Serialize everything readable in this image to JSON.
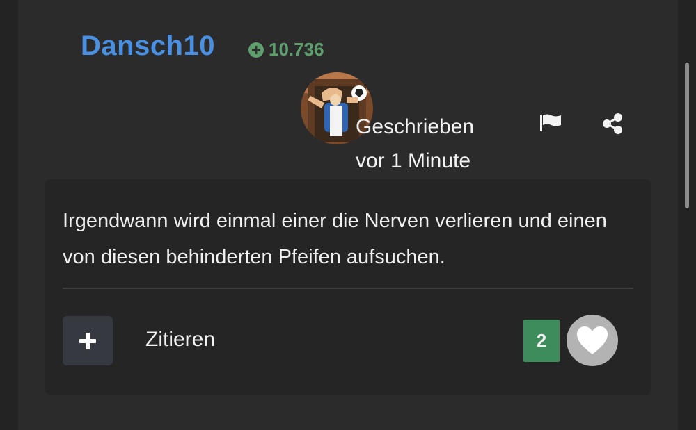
{
  "author": {
    "name": "Dansch10",
    "reputation": "10.736",
    "reputation_icon": "plus-circle-icon"
  },
  "meta": {
    "written_label": "Geschrieben",
    "time_ago": "vor 1 Minute"
  },
  "post": {
    "text": "Irgendwann wird einmal einer die Nerven verlieren und einen von diesen behinderten Pfeifen aufsuchen."
  },
  "actions": {
    "quote_label": "Zitieren",
    "like_count": "2",
    "plus_icon": "plus-icon",
    "like_icon": "heart-icon",
    "report_icon": "flag-icon",
    "share_icon": "share-icon"
  },
  "colors": {
    "username": "#4a90e2",
    "reputation": "#5d9e6c",
    "like_count_bg": "#3e8c5c",
    "like_button_bg": "#b3b3b3"
  }
}
